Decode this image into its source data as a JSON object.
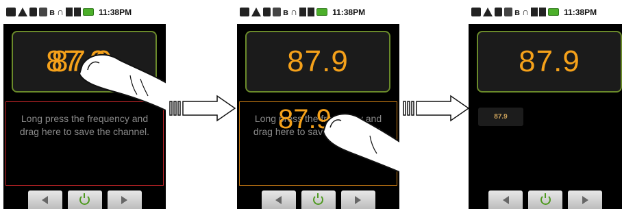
{
  "status_bar": {
    "time": "11:38PM",
    "icons": [
      "message-icon",
      "warning-icon",
      "usb-icon",
      "vibrate-icon",
      "bluetooth-icon",
      "headphones-icon",
      "signal-icon",
      "battery-icon"
    ],
    "bt_glyph": "ʙ",
    "hp_glyph": "∩"
  },
  "screens": {
    "s1": {
      "frequency": "87.9",
      "hint": "Long press the frequency and drag here to save the channel."
    },
    "s2": {
      "frequency": "87.9",
      "hint": "Long press the frequency and drag here to save the channel.",
      "dragging_value": "87.9"
    },
    "s3": {
      "frequency": "87.9",
      "saved_channel": "87.9"
    }
  },
  "colors": {
    "accent": "#f5a11a",
    "frame": "#6a8a2a",
    "zone_red": "#c8262a",
    "zone_orange": "#c97c14"
  }
}
